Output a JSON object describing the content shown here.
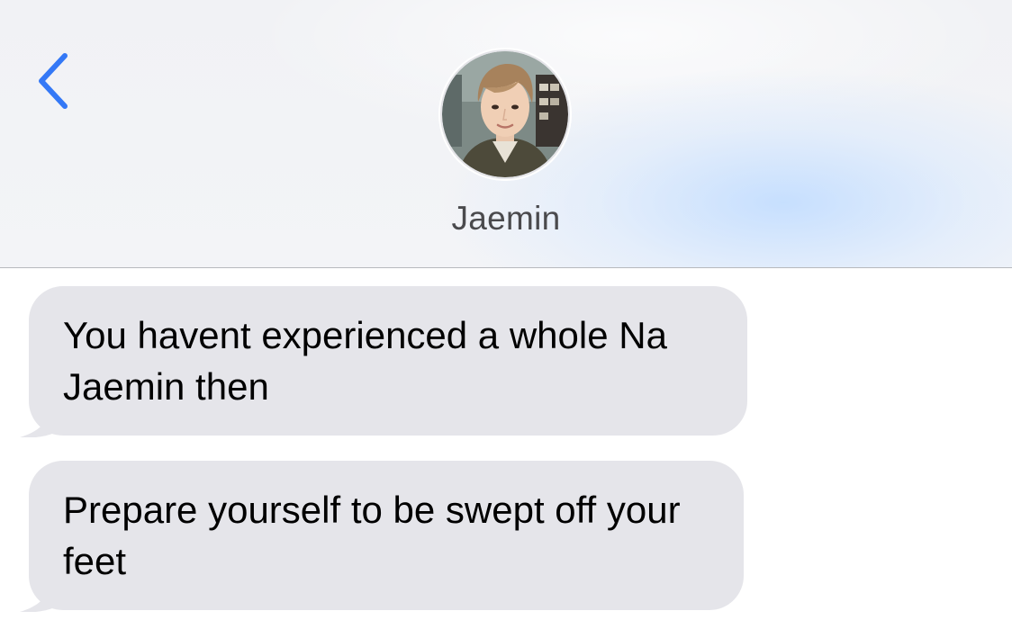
{
  "header": {
    "back_icon": "chevron-left-icon",
    "contact_name": "Jaemin",
    "avatar_icon": "contact-avatar-photo"
  },
  "messages": [
    {
      "text": "You havent experienced a whole Na Jaemin then",
      "direction": "incoming"
    },
    {
      "text": "Prepare yourself to be swept off your feet",
      "direction": "incoming"
    }
  ],
  "colors": {
    "accent": "#3478f6",
    "incoming_bubble": "#e5e5ea",
    "header_bg": "#f2f3f6",
    "name_text": "#4a4a4d"
  }
}
